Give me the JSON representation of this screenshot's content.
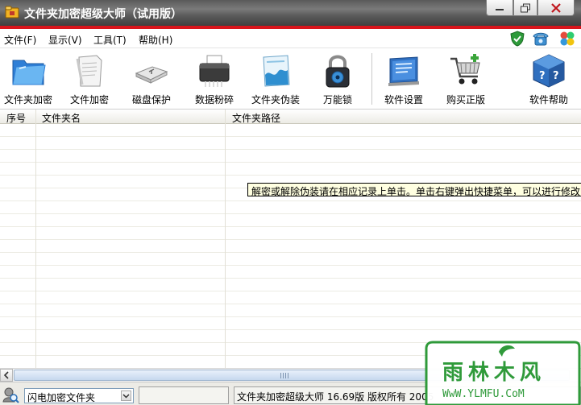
{
  "window": {
    "title": "文件夹加密超级大师（试用版）"
  },
  "menu": {
    "items": [
      {
        "label": "文件(F)"
      },
      {
        "label": "显示(V)"
      },
      {
        "label": "工具(T)"
      },
      {
        "label": "帮助(H)"
      }
    ],
    "right_icons": [
      "shield-check-icon",
      "phone-icon",
      "clover-icon"
    ]
  },
  "toolbar": {
    "buttons": [
      {
        "label": "文件夹加密",
        "icon": "folder-icon"
      },
      {
        "label": "文件加密",
        "icon": "document-icon"
      },
      {
        "label": "磁盘保护",
        "icon": "usb-disk-icon"
      },
      {
        "label": "数据粉碎",
        "icon": "shredder-icon"
      },
      {
        "label": "文件夹伪装",
        "icon": "disguise-folder-icon"
      },
      {
        "label": "万能锁",
        "icon": "padlock-icon"
      },
      {
        "label": "软件设置",
        "icon": "settings-panel-icon"
      },
      {
        "label": "购买正版",
        "icon": "shopping-cart-icon"
      },
      {
        "label": "软件帮助",
        "icon": "help-cube-icon"
      }
    ]
  },
  "table": {
    "columns": [
      "序号",
      "文件夹名",
      "文件夹路径"
    ],
    "rows": [],
    "tooltip": "解密或解除伪装请在相应记录上单击。单击右键弹出快捷菜单，可以进行修改"
  },
  "statusbar": {
    "mode_select": "闪电加密文件夹",
    "info_text": "文件夹加密超级大师 16.69版 版权所有 2005"
  },
  "watermark": {
    "text": "雨林木风",
    "url": "WwW.YLMFU.CoM"
  },
  "colors": {
    "accent_red": "#d8141b",
    "titlebar": "#5a5a5a",
    "tooltip_bg": "#ffffe1",
    "watermark_green": "#2f9a3a"
  }
}
